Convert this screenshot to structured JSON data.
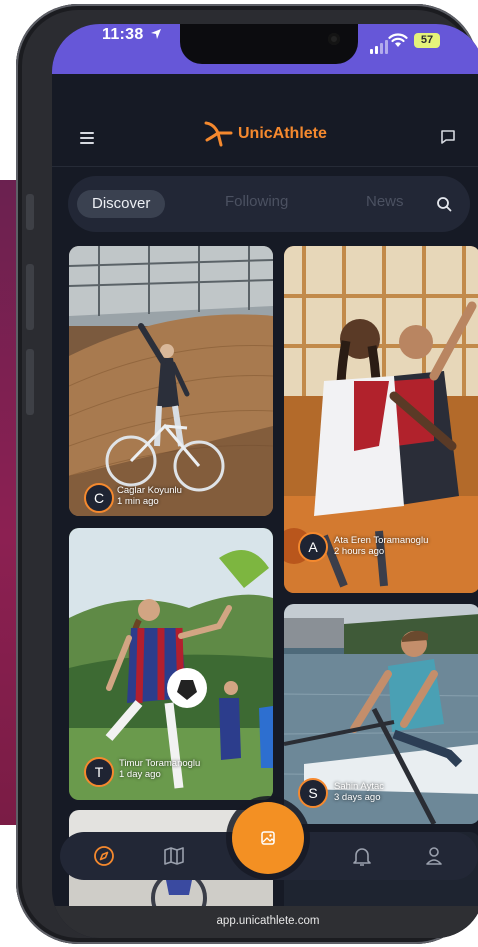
{
  "status_bar": {
    "time": "11:38",
    "battery": "57"
  },
  "app": {
    "name": "UnicAthlete"
  },
  "tabs": [
    {
      "label": "Discover"
    },
    {
      "label": "Following"
    },
    {
      "label": "News"
    }
  ],
  "feed": [
    {
      "initial": "C",
      "name": "Caglar Koyunlu",
      "time": "1 min ago"
    },
    {
      "initial": "A",
      "name": "Ata Eren Toramanoglu",
      "time": "2 hours ago"
    },
    {
      "initial": "T",
      "name": "Timur Toramanoglu",
      "time": "1 day ago"
    },
    {
      "initial": "S",
      "name": "Sahin Aytac",
      "time": "3 days ago"
    }
  ],
  "bottom_nav": [
    "compass-icon",
    "map-icon",
    "image-icon",
    "bell-icon",
    "user-icon"
  ],
  "browser": {
    "url": "app.unicathlete.com"
  },
  "colors": {
    "accent": "#f5892e",
    "background": "#161a25",
    "status_bar": "#6657d8"
  }
}
